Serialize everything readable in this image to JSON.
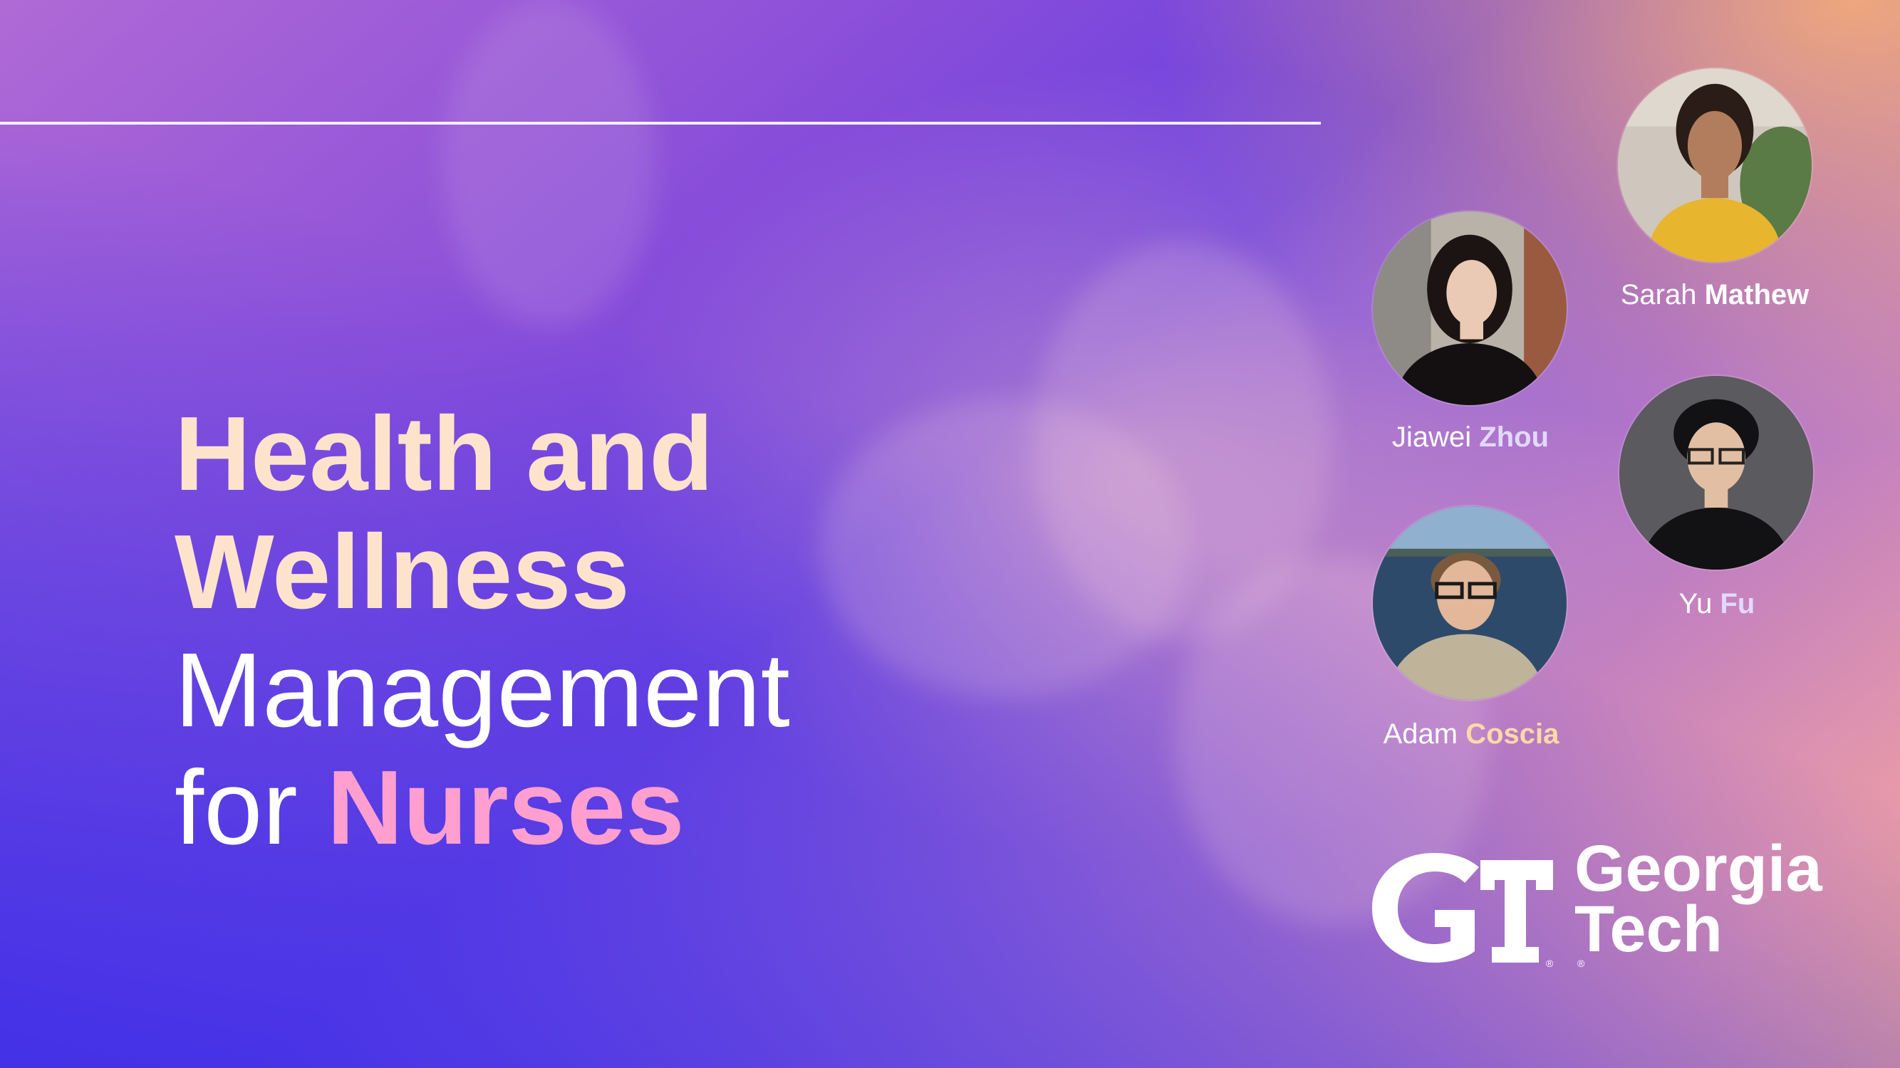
{
  "title": {
    "line1": "Health and",
    "line2": "Wellness",
    "line3": "Management",
    "line4_prefix": "for ",
    "line4_highlight": "Nurses"
  },
  "people": [
    {
      "first": "Sarah",
      "last": "Mathew"
    },
    {
      "first": "Jiawei",
      "last": "Zhou"
    },
    {
      "first": "Yu",
      "last": "Fu"
    },
    {
      "first": "Adam",
      "last": "Coscia"
    }
  ],
  "logo": {
    "monogram": "GT",
    "word1": "Georgia",
    "word2": "Tech",
    "reg_mark": "®"
  },
  "colors": {
    "title_bold": "#fde3cc",
    "title_highlight": "#ff9fd0",
    "accent_peach": "#ffd9a8",
    "accent_lavender": "#e2d9ff"
  }
}
